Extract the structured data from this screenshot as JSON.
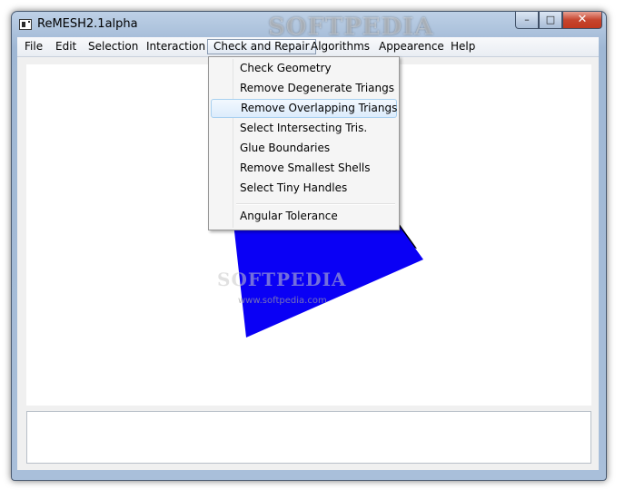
{
  "window": {
    "title": "ReMESH2.1alpha",
    "watermark": "SOFTPEDIA",
    "controls": {
      "minimize": "–",
      "maximize": "□",
      "close": "✕"
    }
  },
  "menubar": {
    "items": [
      {
        "label": "File"
      },
      {
        "label": "Edit"
      },
      {
        "label": "Selection"
      },
      {
        "label": "Interaction"
      },
      {
        "label": "Check and Repair"
      },
      {
        "label": "Algorithms"
      },
      {
        "label": "Appearence"
      },
      {
        "label": "Help"
      }
    ],
    "active_index": 4
  },
  "dropdown": {
    "items": [
      {
        "label": "Check Geometry"
      },
      {
        "label": "Remove Degenerate Triangs"
      },
      {
        "label": "Remove Overlapping Triangs"
      },
      {
        "label": "Select Intersecting Tris."
      },
      {
        "label": "Glue Boundaries"
      },
      {
        "label": "Remove Smallest Shells"
      },
      {
        "label": "Select Tiny Handles"
      },
      {
        "label": "Angular Tolerance"
      }
    ],
    "hover_index": 2
  },
  "viewport": {
    "mesh_color": "#0a00f5",
    "edge_color": "#000000",
    "watermark_text": "SOFTPEDIA",
    "watermark_url": "www.softpedia.com"
  },
  "icons": [
    "app-icon",
    "minimize-icon",
    "maximize-icon",
    "close-icon"
  ]
}
